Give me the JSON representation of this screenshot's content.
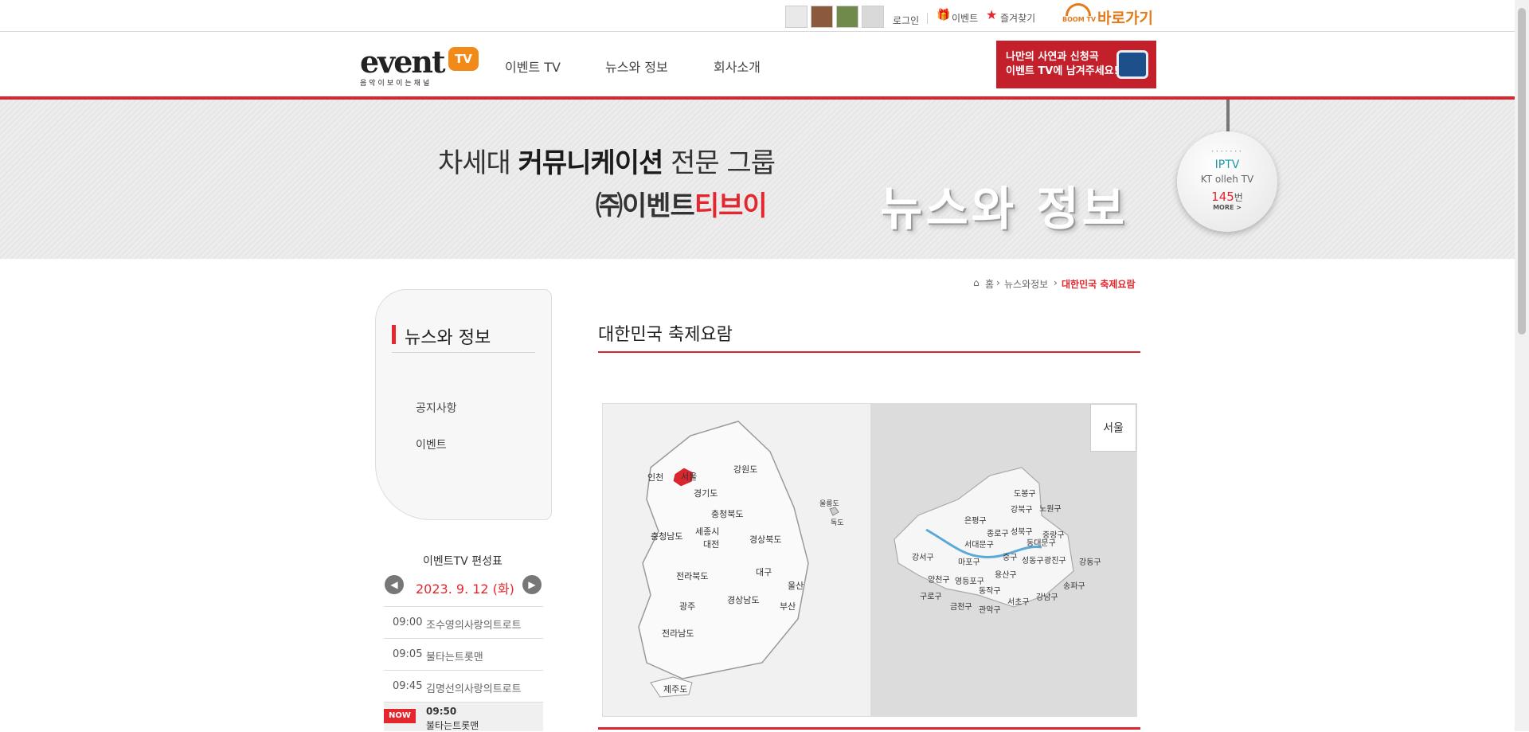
{
  "topbar": {
    "login": "로그인",
    "event": "이벤트",
    "favorites": "즐겨찾기",
    "boom_logo": "BOOM TV",
    "shortcut": "바로가기"
  },
  "header": {
    "logo_text": "event",
    "logo_tv": "TV",
    "logo_tagline": "음악이보이는채널",
    "nav": [
      "이벤트 TV",
      "뉴스와 정보",
      "회사소개"
    ],
    "promo_line1": "나만의 사연과 신청곡",
    "promo_line2": "이벤트 TV에 남겨주세요!"
  },
  "hero": {
    "line1_prefix": "차세대 ",
    "line1_bold": "커뮤니케이션",
    "line1_suffix": " 전문 그룹",
    "line2_prefix": "㈜이벤트",
    "line2_red": "티브이",
    "title": "뉴스와 정보",
    "iptv_label": "IPTV",
    "iptv_provider": "KT olleh TV",
    "iptv_channel": "145",
    "iptv_unit": "번",
    "iptv_more": "MORE >"
  },
  "breadcrumb": {
    "home": "홈",
    "parent": "뉴스와정보",
    "current": "대한민국 축제요람"
  },
  "sidebar": {
    "title": "뉴스와 정보",
    "items": [
      "공지사항",
      "이벤트"
    ]
  },
  "schedule": {
    "title": "이벤트TV 편성표",
    "date": "2023. 9. 12 (화)",
    "rows": [
      {
        "time": "09:00",
        "program": "조수영의사랑의트로트"
      },
      {
        "time": "09:05",
        "program": "불타는트롯맨"
      },
      {
        "time": "09:45",
        "program": "김명선의사랑의트로트"
      }
    ],
    "now_badge": "NOW",
    "now_time": "09:50",
    "now_program": "불타는트롯맨"
  },
  "main": {
    "title": "대한민국 축제요람",
    "selected_region": "서울",
    "accent_color": "#d9252d",
    "regions": [
      "인천",
      "서울",
      "강원도",
      "경기도",
      "충청북도",
      "울릉도",
      "독도",
      "충청남도",
      "세종시",
      "대전",
      "경상북도",
      "대구",
      "전라북도",
      "울산",
      "경상남도",
      "부산",
      "광주",
      "전라남도",
      "제주도"
    ],
    "districts": [
      "도봉구",
      "강북구",
      "노원구",
      "은평구",
      "종로구",
      "성북구",
      "중랑구",
      "서대문구",
      "동대문구",
      "강서구",
      "마포구",
      "중구",
      "성동구",
      "광진구",
      "강동구",
      "양천구",
      "영등포구",
      "용산구",
      "구로구",
      "동작구",
      "서초구",
      "강남구",
      "송파구",
      "금천구",
      "관악구"
    ]
  }
}
